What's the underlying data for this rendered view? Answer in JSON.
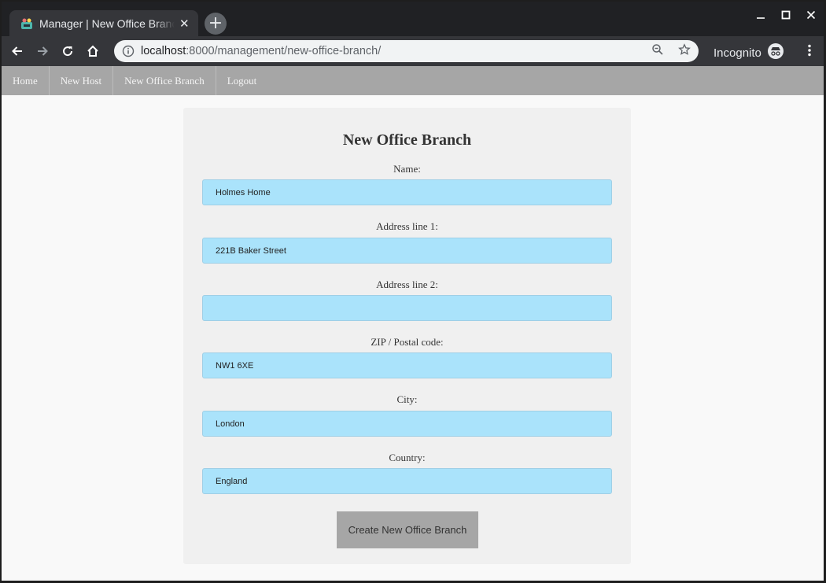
{
  "browser": {
    "tab_title": "Manager | New Office Branch",
    "tab_close": "✕",
    "new_tab": "+",
    "url_host": "localhost",
    "url_path": ":8000/management/new-office-branch/",
    "incognito_label": "Incognito"
  },
  "navbar": {
    "items": [
      {
        "label": "Home"
      },
      {
        "label": "New Host"
      },
      {
        "label": "New Office Branch"
      },
      {
        "label": "Logout"
      }
    ]
  },
  "form": {
    "title": "New Office Branch",
    "fields": [
      {
        "label": "Name:",
        "value": "Holmes Home"
      },
      {
        "label": "Address line 1:",
        "value": "221B Baker Street"
      },
      {
        "label": "Address line 2:",
        "value": ""
      },
      {
        "label": "ZIP / Postal code:",
        "value": "NW1 6XE"
      },
      {
        "label": "City:",
        "value": "London"
      },
      {
        "label": "Country:",
        "value": "England"
      }
    ],
    "submit_label": "Create New Office Branch"
  },
  "colors": {
    "input_bg": "#aae3fb",
    "navbar_bg": "#a6a6a6",
    "button_bg": "#a6a6a6"
  }
}
